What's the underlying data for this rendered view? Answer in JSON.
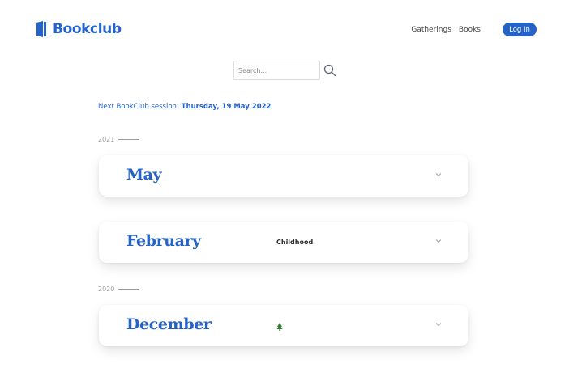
{
  "brand": {
    "name": "Bookclub",
    "color": "#2563c9",
    "icon": "door-book-icon"
  },
  "nav": {
    "gatherings": "Gatherings",
    "books": "Books",
    "login": "Log In"
  },
  "search": {
    "placeholder": "Search...",
    "value": "",
    "icon": "search-icon"
  },
  "next_session": {
    "label": "Next BookClub session:",
    "date": "Thursday, 19 May 2022"
  },
  "years": [
    {
      "year": "2021",
      "months": [
        {
          "name": "May",
          "theme": "",
          "icon": "chevron-down-icon"
        },
        {
          "name": "February",
          "theme": "Childhood",
          "icon": "chevron-down-icon"
        }
      ]
    },
    {
      "year": "2020",
      "months": [
        {
          "name": "December",
          "theme_icon": "tree-icon",
          "theme_icon_color": "#2e7d32",
          "icon": "chevron-down-icon"
        }
      ]
    }
  ]
}
